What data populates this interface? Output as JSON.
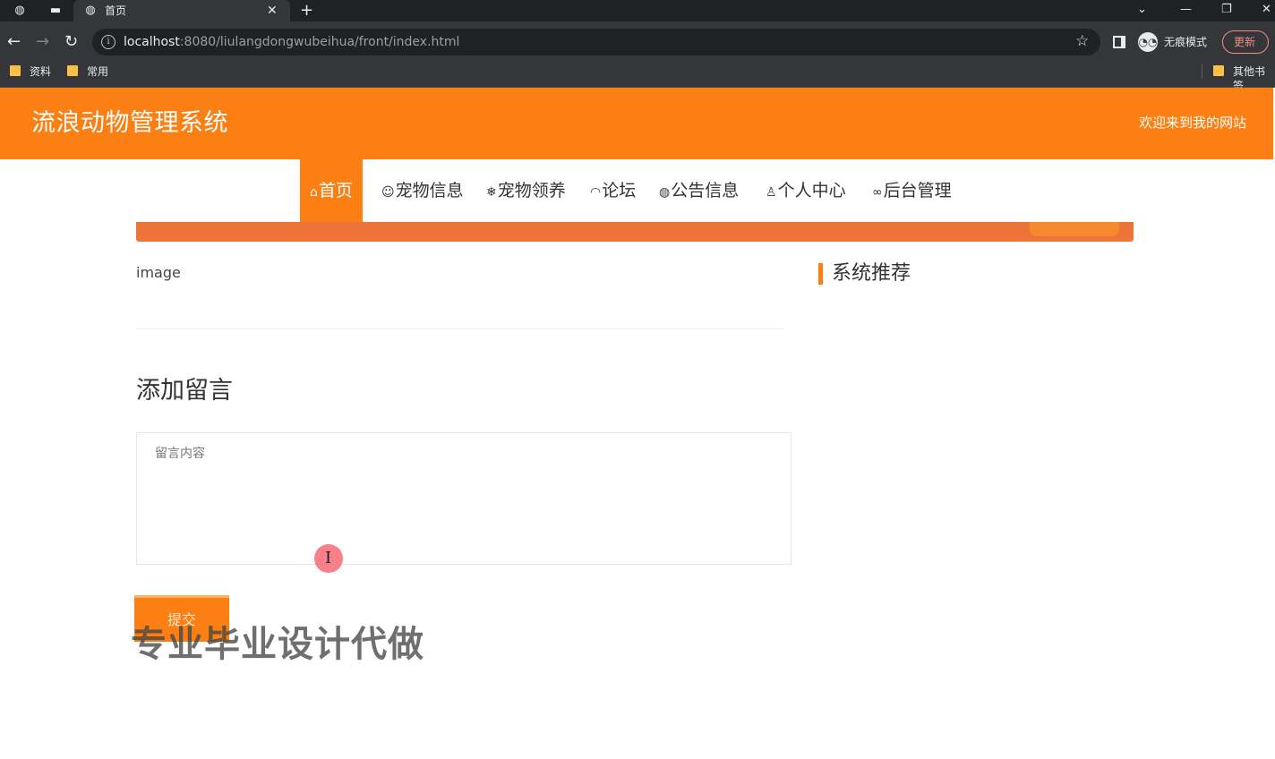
{
  "browser": {
    "tab_title": "首页",
    "url_host": "localhost",
    "url_rest": ":8080/liulangdongwubeihua/front/index.html",
    "incognito_label": "无痕模式",
    "update_label": "更新",
    "bookmarks": [
      {
        "label": "资料"
      },
      {
        "label": "常用"
      },
      {
        "label": "其他书签"
      }
    ]
  },
  "site": {
    "title": "流浪动物管理系统",
    "welcome": "欢迎来到我的网站",
    "accent_color": "#fb7f12"
  },
  "nav": {
    "items": [
      {
        "icon": "home-icon",
        "label": "首页",
        "active": true
      },
      {
        "icon": "pet-icon",
        "label": "宠物信息",
        "active": false
      },
      {
        "icon": "snowflake-icon",
        "label": "宠物领养",
        "active": false
      },
      {
        "icon": "forum-icon",
        "label": "论坛",
        "active": false
      },
      {
        "icon": "globe-icon",
        "label": "公告信息",
        "active": false
      },
      {
        "icon": "user-icon",
        "label": "个人中心",
        "active": false
      },
      {
        "icon": "link-icon",
        "label": "后台管理",
        "active": false
      }
    ]
  },
  "main": {
    "image_alt": "image",
    "recommend_title": "系统推荐",
    "add_message_title": "添加留言",
    "message_placeholder": "留言内容",
    "submit_label": "提交",
    "watermark": "专业毕业设计代做"
  }
}
